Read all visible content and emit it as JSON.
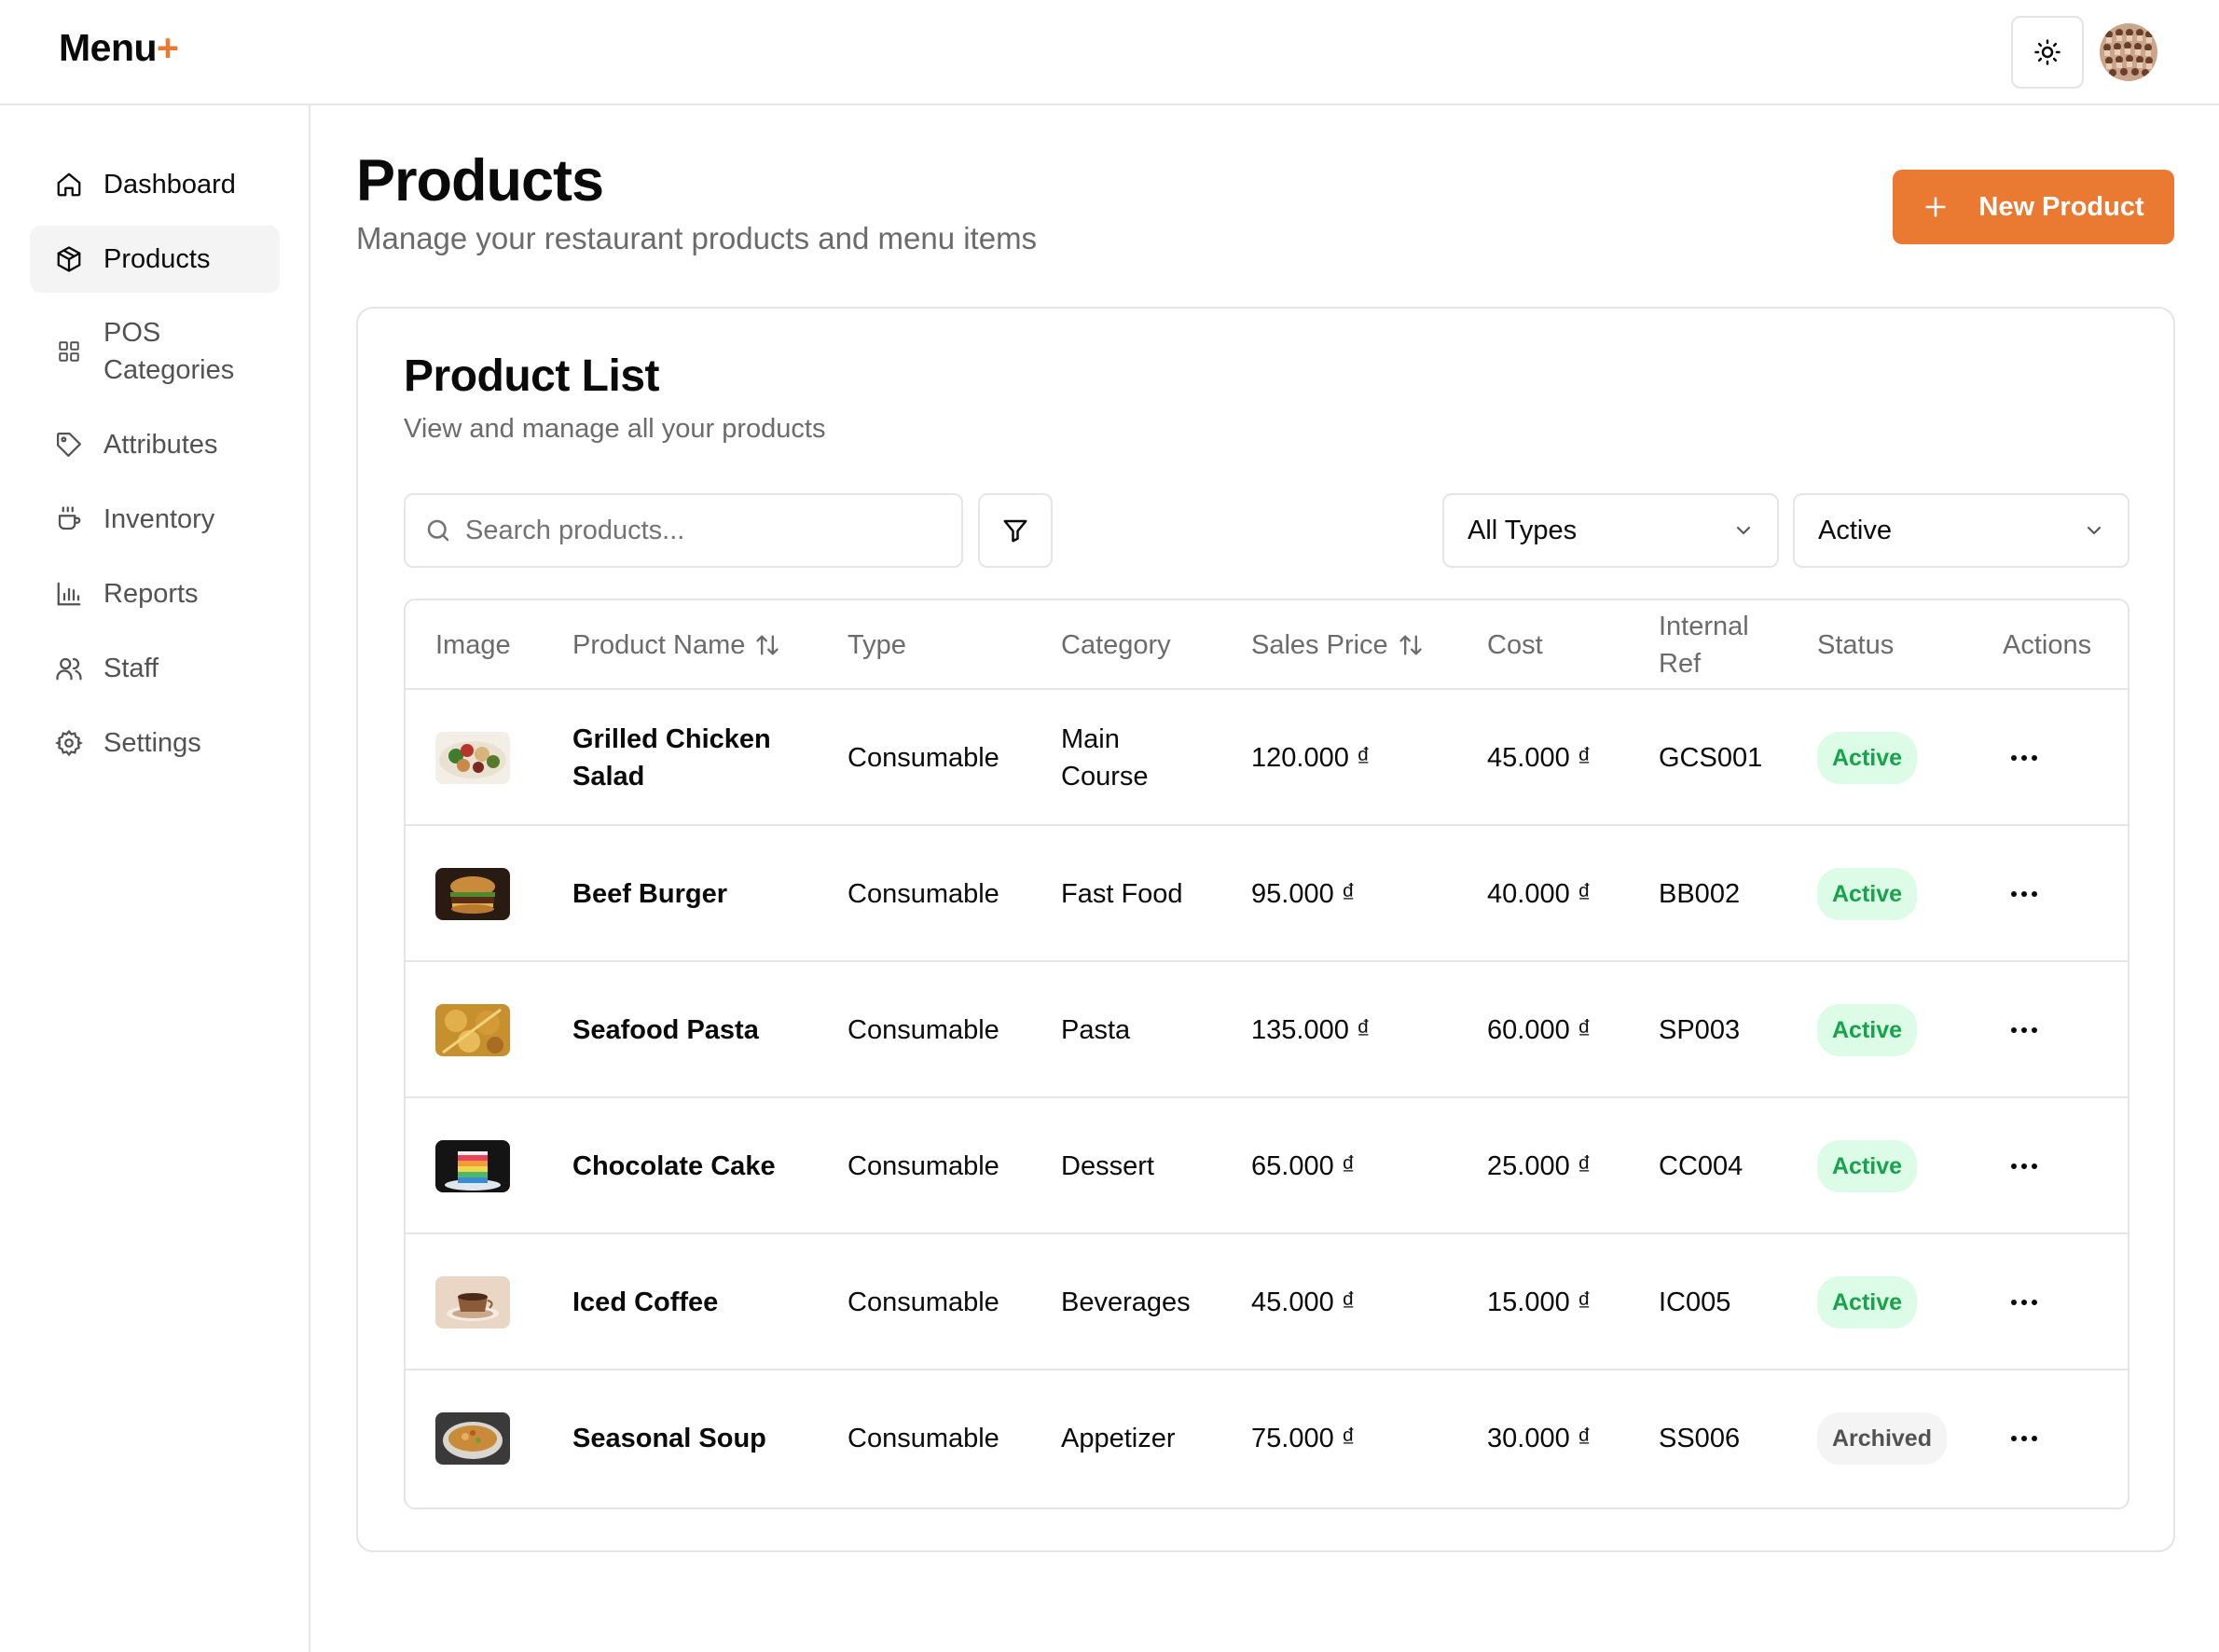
{
  "app": {
    "logo_text": "Menu",
    "logo_plus": "+"
  },
  "header": {
    "theme_icon": "sun-icon",
    "avatar_icon": "user-avatar"
  },
  "sidebar": {
    "items": [
      {
        "label": "Dashboard",
        "icon": "home-icon",
        "active": false
      },
      {
        "label": "Products",
        "icon": "package-icon",
        "active": true
      },
      {
        "label": "POS Categories",
        "icon": "grid-icon",
        "active": false
      },
      {
        "label": "Attributes",
        "icon": "tag-icon",
        "active": false
      },
      {
        "label": "Inventory",
        "icon": "cup-icon",
        "active": false
      },
      {
        "label": "Reports",
        "icon": "bar-chart-icon",
        "active": false
      },
      {
        "label": "Staff",
        "icon": "users-icon",
        "active": false
      },
      {
        "label": "Settings",
        "icon": "gear-icon",
        "active": false
      }
    ]
  },
  "page": {
    "title": "Products",
    "subtitle": "Manage your restaurant products and menu items",
    "new_button": "New Product"
  },
  "card": {
    "title": "Product List",
    "subtitle": "View and manage all your products"
  },
  "filters": {
    "search_placeholder": "Search products...",
    "type_select": "All Types",
    "status_select": "Active"
  },
  "table": {
    "columns": [
      "Image",
      "Product Name",
      "Type",
      "Category",
      "Sales Price",
      "Cost",
      "Internal Ref",
      "Status",
      "Actions"
    ],
    "rows": [
      {
        "image": "salad-image",
        "name": "Grilled Chicken Salad",
        "type": "Consumable",
        "category": "Main Course",
        "price": "120.000 ₫",
        "cost": "45.000 ₫",
        "ref": "GCS001",
        "status": "Active"
      },
      {
        "image": "burger-image",
        "name": "Beef Burger",
        "type": "Consumable",
        "category": "Fast Food",
        "price": "95.000 ₫",
        "cost": "40.000 ₫",
        "ref": "BB002",
        "status": "Active"
      },
      {
        "image": "pasta-image",
        "name": "Seafood Pasta",
        "type": "Consumable",
        "category": "Pasta",
        "price": "135.000 ₫",
        "cost": "60.000 ₫",
        "ref": "SP003",
        "status": "Active"
      },
      {
        "image": "cake-image",
        "name": "Chocolate Cake",
        "type": "Consumable",
        "category": "Dessert",
        "price": "65.000 ₫",
        "cost": "25.000 ₫",
        "ref": "CC004",
        "status": "Active"
      },
      {
        "image": "coffee-image",
        "name": "Iced Coffee",
        "type": "Consumable",
        "category": "Beverages",
        "price": "45.000 ₫",
        "cost": "15.000 ₫",
        "ref": "IC005",
        "status": "Active"
      },
      {
        "image": "soup-image",
        "name": "Seasonal Soup",
        "type": "Consumable",
        "category": "Appetizer",
        "price": "75.000 ₫",
        "cost": "30.000 ₫",
        "ref": "SS006",
        "status": "Archived"
      }
    ]
  },
  "colors": {
    "accent": "#ea7a32",
    "active_badge_bg": "#dcfce7",
    "active_badge_text": "#16a34a",
    "archived_badge_bg": "#f4f4f5"
  }
}
